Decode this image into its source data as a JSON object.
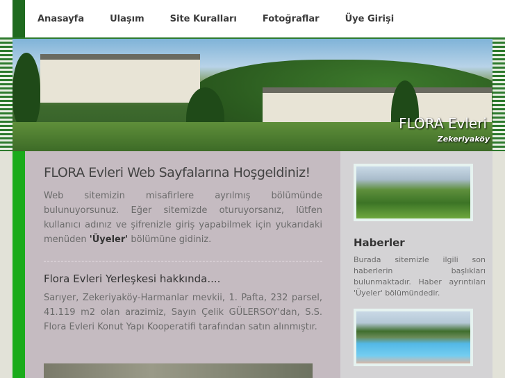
{
  "nav": {
    "items": [
      {
        "label": "Anasayfa"
      },
      {
        "label": "Ulaşım"
      },
      {
        "label": "Site Kuralları"
      },
      {
        "label": "Fotoğraflar"
      },
      {
        "label": "Üye Girişi"
      }
    ]
  },
  "banner": {
    "title": "FLORA Evleri",
    "subtitle": "Zekeriyaköy"
  },
  "main": {
    "heading": "FLORA Evleri Web Sayfalarına Hoşgeldiniz!",
    "intro_before": "Web sitemizin misafirlere ayrılmış bölümünde bulunuyorsunuz. Eğer sitemizde oturuyorsanız, lütfen kullanıcı adınız ve şifrenizle giriş yapabilmek için yukarıdaki menüden ",
    "intro_strong": "'Üyeler'",
    "intro_after": " bölümüne gidiniz.",
    "section_heading": "Flora Evleri Yerleşkesi hakkında....",
    "section_text": "Sarıyer, Zekeriyaköy-Harmanlar mevkii, 1. Pafta, 232 parsel, 41.119 m2 olan arazimiz, Sayın Çelik GÜLERSOY'dan, S.S. Flora Evleri Konut Yapı Kooperatifi tarafından satın alınmıştır."
  },
  "sidebar": {
    "news_heading": "Haberler",
    "news_text": "Burada sitemizle ilgili son haberlerin başlıkları bulunmaktadır. Haber ayrıntıları 'Üyeler' bölümündedir."
  },
  "colors": {
    "nav_strip": "#1f6a1f",
    "left_strip": "#1aab1a",
    "content_bg": "#c5bbc1",
    "sidebar_bg": "#d4d3d5"
  }
}
